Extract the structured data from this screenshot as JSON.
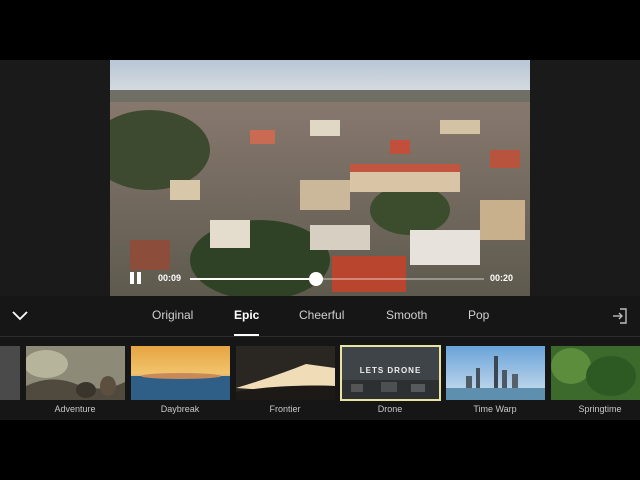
{
  "player": {
    "current_time": "00:09",
    "total_time": "00:20",
    "progress": 0.43
  },
  "style_tabs": [
    {
      "label": "Original",
      "active": false
    },
    {
      "label": "Epic",
      "active": true
    },
    {
      "label": "Cheerful",
      "active": false
    },
    {
      "label": "Smooth",
      "active": false
    },
    {
      "label": "Pop",
      "active": false
    }
  ],
  "themes": [
    {
      "label": "Adventure",
      "selected": false
    },
    {
      "label": "Daybreak",
      "selected": false
    },
    {
      "label": "Frontier",
      "selected": false
    },
    {
      "label": "Drone",
      "selected": true,
      "overlay_text": "LETS DRONE"
    },
    {
      "label": "Time Warp",
      "selected": false
    },
    {
      "label": "Springtime",
      "selected": false
    }
  ],
  "colors": {
    "panel_bg": "#161616",
    "selected_border": "#e8e3a0",
    "accent": "#ffffff"
  },
  "icons": {
    "collapse": "chevron-down-icon",
    "play_state": "pause-icon",
    "export": "export-icon"
  }
}
